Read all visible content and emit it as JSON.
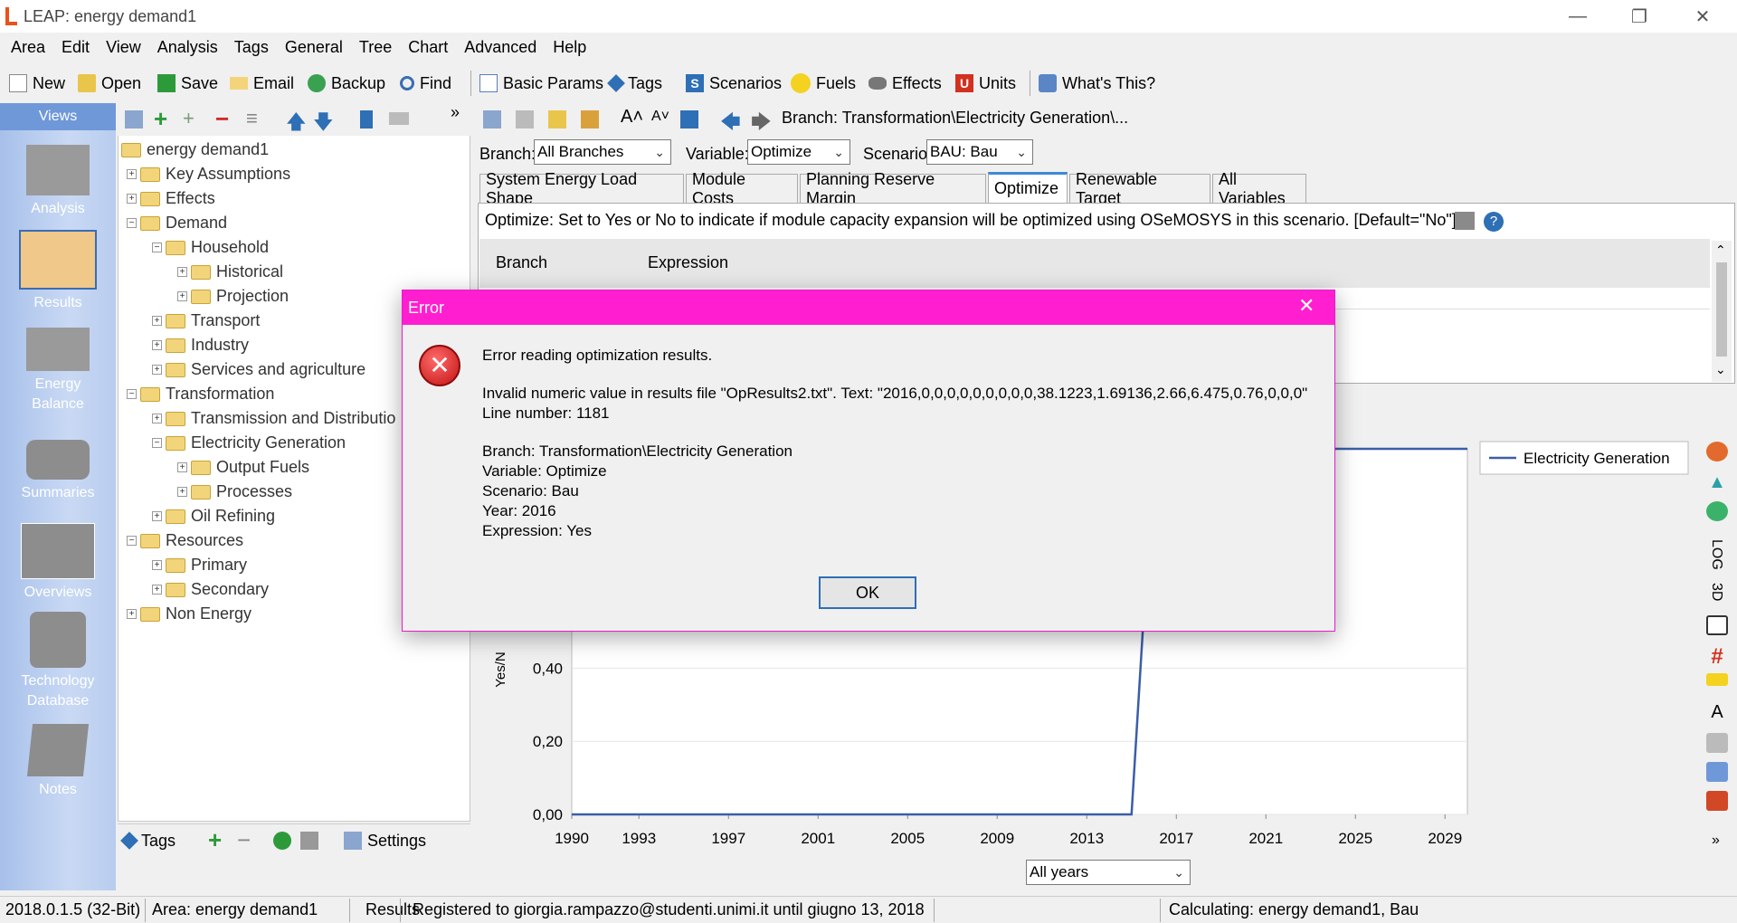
{
  "window": {
    "title": "LEAP: energy demand1",
    "accent": "#e8531c"
  },
  "menu": [
    "Area",
    "Edit",
    "View",
    "Analysis",
    "Tags",
    "General",
    "Tree",
    "Chart",
    "Advanced",
    "Help"
  ],
  "toolbar": {
    "new": "New",
    "open": "Open",
    "save": "Save",
    "email": "Email",
    "backup": "Backup",
    "find": "Find",
    "basic_params": "Basic Params",
    "tags": "Tags",
    "scenarios": "Scenarios",
    "fuels": "Fuels",
    "effects": "Effects",
    "units": "Units",
    "whats_this": "What's This?"
  },
  "views": {
    "header": "Views",
    "items": [
      "Analysis",
      "Results",
      "Energy Balance",
      "Summaries",
      "Overviews",
      "Technology Database",
      "Notes"
    ]
  },
  "tree": {
    "root": "energy demand1",
    "nodes": [
      "Key Assumptions",
      "Effects",
      "Demand",
      "Household",
      "Historical",
      "Projection",
      "Transport",
      "Industry",
      "Services and agriculture",
      "Transformation",
      "Transmission and Distributio",
      "Electricity Generation",
      "Output Fuels",
      "Processes",
      "Oil Refining",
      "Resources",
      "Primary",
      "Secondary",
      "Non Energy"
    ],
    "bottom": {
      "tags": "Tags",
      "settings": "Settings"
    }
  },
  "right": {
    "breadcrumb": "Branch: Transformation\\Electricity Generation\\...",
    "branch_label": "Branch:",
    "branch_value": "All Branches",
    "variable_label": "Variable:",
    "variable_value": "Optimize",
    "scenario_label": "Scenario:",
    "scenario_value": "BAU: Bau",
    "tabs": [
      "System Energy Load Shape",
      "Module Costs",
      "Planning Reserve Margin",
      "Optimize",
      "Renewable Target",
      "All Variables"
    ],
    "active_tab": "Optimize",
    "description": "Optimize: Set to Yes or No to indicate if module capacity expansion will be optimized using OSeMOSYS in this scenario. [Default=\"No\"]",
    "grid_cols": [
      "Branch",
      "Expression"
    ],
    "years_select": "All years",
    "side_labels": [
      "LOG",
      "3D"
    ]
  },
  "chart_data": {
    "type": "line",
    "title": "",
    "ylabel": "Yes/N",
    "x_ticks": [
      "1990",
      "1993",
      "1997",
      "2001",
      "2005",
      "2009",
      "2013",
      "2017",
      "2021",
      "2025",
      "2029"
    ],
    "y_ticks": [
      "0,00",
      "0,20",
      "0,40"
    ],
    "xlim": [
      1990,
      2030
    ],
    "ylim": [
      0,
      1
    ],
    "series": [
      {
        "name": "Electricity Generation",
        "color": "#3b5ea8",
        "x": [
          1990,
          2015,
          2016,
          2030
        ],
        "y": [
          0,
          0,
          1,
          1
        ]
      }
    ],
    "legend": "top-right"
  },
  "dialog": {
    "title": "Error",
    "heading": "Error reading optimization results.",
    "message": "Invalid numeric value in results file \"OpResults2.txt\". Text: \"2016,0,0,0,0,0,0,0,0,0,38.1223,1.69136,2.66,6.475,0.76,0,0,0\"",
    "line": "Line number: 1181",
    "branch": "Branch: Transformation\\Electricity Generation",
    "variable": "Variable: Optimize",
    "scenario": "Scenario: Bau",
    "year": "Year: 2016",
    "expression": "Expression: Yes",
    "ok": "OK"
  },
  "status": {
    "version": "2018.0.1.5 (32-Bit)",
    "area": "Area: energy demand1",
    "view": "Results",
    "registered": "Registered to giorgia.rampazzo@studenti.unimi.it until giugno 13, 2018",
    "calculating": "Calculating: energy demand1, Bau"
  }
}
